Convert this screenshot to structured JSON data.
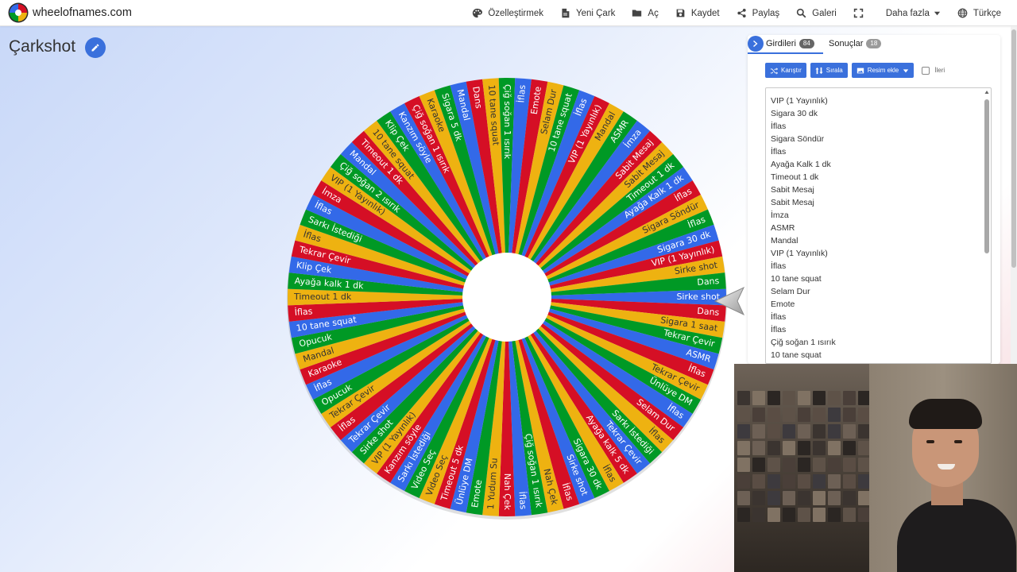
{
  "nav": {
    "brand": "wheelofnames.com",
    "items": [
      {
        "label": "Özelleştirmek",
        "icon": "palette-icon"
      },
      {
        "label": "Yeni Çark",
        "icon": "document-icon"
      },
      {
        "label": "Aç",
        "icon": "folder-icon"
      },
      {
        "label": "Kaydet",
        "icon": "save-icon"
      },
      {
        "label": "Paylaş",
        "icon": "share-icon"
      },
      {
        "label": "Galeri",
        "icon": "search-icon"
      },
      {
        "label": "",
        "icon": "fullscreen-icon"
      },
      {
        "label": "Daha fazla",
        "icon": "chevron-down-icon"
      },
      {
        "label": "Türkçe",
        "icon": "globe-icon"
      }
    ]
  },
  "title": "Çarkshot",
  "panel": {
    "tab_entries": "Girdileri",
    "tab_entries_count": "84",
    "tab_results": "Sonuçlar",
    "tab_results_count": "18",
    "shuffle": "Karıştır",
    "sort": "Sırala",
    "add_image": "Resim ekle",
    "advanced": "İleri",
    "entries": [
      "VIP (1 Yayınlık)",
      "Sigara 30 dk",
      "İflas",
      "Sigara Söndür",
      "İflas",
      "Ayağa Kalk 1 dk",
      "Timeout 1 dk",
      "Sabit Mesaj",
      "Sabit Mesaj",
      "İmza",
      "ASMR",
      "Mandal",
      "VIP (1 Yayınlık)",
      "İflas",
      "10 tane squat",
      "Selam Dur",
      "Emote",
      "İflas",
      "İflas",
      "Çiğ soğan 1 ısırık",
      "10 tane squat"
    ]
  },
  "wheel": {
    "colors": [
      "#3369e8",
      "#d50f25",
      "#eeb211",
      "#009925"
    ],
    "labels": [
      "Sirke shot",
      "Dans",
      "Sigara 1 saat",
      "Tekrar Çevir",
      "ASMR",
      "İflas",
      "Tekrar Çevir",
      "Ünlüye DM",
      "İflas",
      "Selam Dur",
      "İflas",
      "Sarkı İstediği",
      "Tekrar Çevir",
      "Ayağa kalk 5 dk",
      "İflas",
      "Sigara 30 dk",
      "Sirke shot",
      "İflas",
      "Nah Çek",
      "Çiğ soğan 1 ısırık",
      "İflas",
      "Nah Çek",
      "1 Yudum Su",
      "Emote",
      "Ünlüye DM",
      "Timeout 5 dk",
      "Video Seç",
      "Video Seç",
      "Sarkı İstediği",
      "Kanzım söyle",
      "VIP (1 Yayınlık)",
      "Sirke shot",
      "Tekrar Çevir",
      "İflas",
      "Tekrar Çevir",
      "Opucuk",
      "İflas",
      "Karaoke",
      "Mandal",
      "Opucuk",
      "10 tane squat",
      "İflas",
      "Timeout 1 dk",
      "Ayağa kalk 1 dk",
      "Klip Çek",
      "Tekrar Çevir",
      "İflas",
      "Sarkı İstediği",
      "İflas",
      "İmza",
      "VIP (1 Yayınlık)",
      "Çiğ soğan 2 ısırık",
      "Mandal",
      "Timeout 1 dk",
      "10 tane squat",
      "Klip Çek",
      "Kanzım söyle",
      "Çiğ soğan 1 ısırık",
      "Karaoke",
      "Sigara 5 dk",
      "Mandal",
      "Dans",
      "10 tane squat",
      "Çiğ soğan 1 ısırık",
      "İflas",
      "Emote",
      "Selam Dur",
      "10 tane squat",
      "İflas",
      "VIP (1 Yayınlık)",
      "Mandal",
      "ASMR",
      "İmza",
      "Sabit Mesaj",
      "Sabit Mesaj",
      "Timeout 1 dk",
      "Ayağa Kalk 1 dk",
      "İflas",
      "Sigara Söndür",
      "İflas",
      "Sigara 30 dk",
      "VIP (1 Yayınlık)",
      "Sirke shot",
      "Dans"
    ]
  }
}
